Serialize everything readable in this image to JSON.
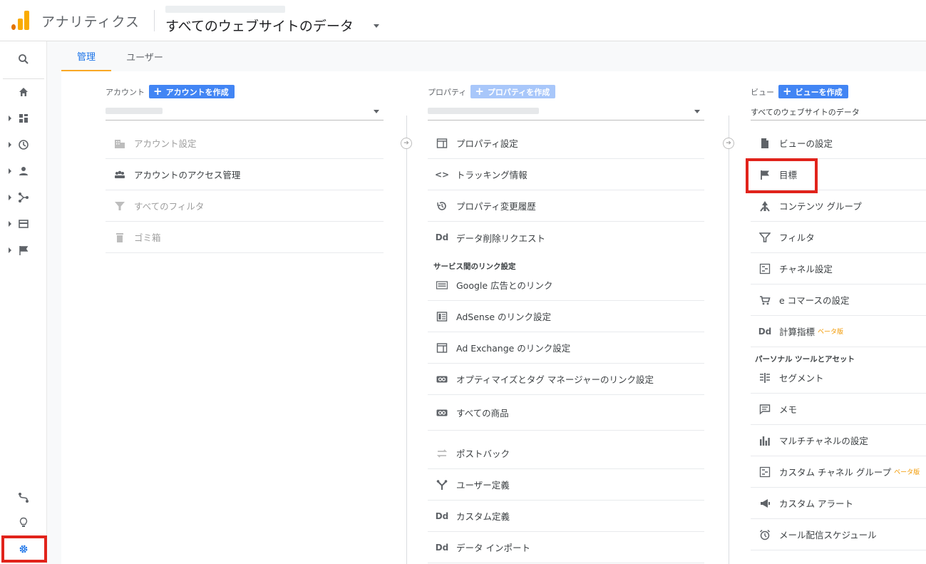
{
  "header": {
    "app_name": "アナリティクス",
    "view_title": "すべてのウェブサイトのデータ",
    "brand_colors": {
      "orange": "#f9ab00",
      "dark_orange": "#e37400"
    }
  },
  "left_nav": {
    "items": [
      {
        "name": "search-icon"
      },
      {
        "name": "home-icon"
      },
      {
        "name": "customization-icon"
      },
      {
        "name": "realtime-icon"
      },
      {
        "name": "audience-icon"
      },
      {
        "name": "acquisition-icon"
      },
      {
        "name": "behavior-icon"
      },
      {
        "name": "conversions-icon"
      },
      {
        "name": "attribution-icon"
      },
      {
        "name": "discover-icon"
      },
      {
        "name": "admin-gear-icon"
      }
    ]
  },
  "tabs": [
    {
      "label": "管理",
      "active": true
    },
    {
      "label": "ユーザー",
      "active": false
    }
  ],
  "account": {
    "label": "アカウント",
    "create_button": "アカウントを作成",
    "items": [
      {
        "label": "アカウント設定",
        "icon": "building-icon",
        "disabled": true
      },
      {
        "label": "アカウントのアクセス管理",
        "icon": "people-icon",
        "disabled": false
      },
      {
        "label": "すべてのフィルタ",
        "icon": "filter-icon",
        "disabled": true
      },
      {
        "label": "ゴミ箱",
        "icon": "trash-icon",
        "disabled": true
      }
    ]
  },
  "property": {
    "label": "プロパティ",
    "create_button": "プロパティを作成",
    "items": [
      {
        "label": "プロパティ設定",
        "icon": "window-icon"
      },
      {
        "label": "トラッキング情報",
        "icon": "code-icon",
        "glyph": "<>"
      },
      {
        "label": "プロパティ変更履歴",
        "icon": "history-icon"
      },
      {
        "label": "データ削除リクエスト",
        "icon": "dd-icon",
        "glyph": "Dd"
      }
    ],
    "section_title": "サービス間のリンク設定",
    "link_items": [
      {
        "label": "Google 広告とのリンク",
        "icon": "google-ads-icon"
      },
      {
        "label": "AdSense のリンク設定",
        "icon": "adsense-icon"
      },
      {
        "label": "Ad Exchange のリンク設定",
        "icon": "ad-exchange-icon"
      },
      {
        "label": "オプティマイズとタグ マネージャーのリンク設定",
        "icon": "link-icon"
      },
      {
        "label": "すべての商品",
        "icon": "link-icon"
      }
    ],
    "more_items": [
      {
        "label": "ポストバック",
        "icon": "postback-icon"
      },
      {
        "label": "ユーザー定義",
        "icon": "user-defined-icon"
      },
      {
        "label": "カスタム定義",
        "icon": "dd-icon",
        "glyph": "Dd"
      },
      {
        "label": "データ インポート",
        "icon": "dd-icon",
        "glyph": "Dd"
      }
    ]
  },
  "view": {
    "label": "ビュー",
    "create_button": "ビューを作成",
    "selected": "すべてのウェブサイトのデータ",
    "items": [
      {
        "label": "ビューの設定",
        "icon": "document-icon"
      },
      {
        "label": "目標",
        "icon": "flag-icon"
      },
      {
        "label": "コンテンツ グループ",
        "icon": "content-group-icon"
      },
      {
        "label": "フィルタ",
        "icon": "filter-icon"
      },
      {
        "label": "チャネル設定",
        "icon": "channel-icon"
      },
      {
        "label": "e コマースの設定",
        "icon": "cart-icon"
      },
      {
        "label": "計算指標",
        "icon": "dd-icon",
        "glyph": "Dd",
        "badge": "ベータ版"
      }
    ],
    "section_title": "パーソナル ツールとアセット",
    "tool_items": [
      {
        "label": "セグメント",
        "icon": "segment-icon"
      },
      {
        "label": "メモ",
        "icon": "annotation-icon"
      },
      {
        "label": "マルチチャネルの設定",
        "icon": "bar-chart-icon"
      },
      {
        "label": "カスタム チャネル グループ",
        "icon": "channel-icon",
        "badge": "ベータ版"
      },
      {
        "label": "カスタム アラート",
        "icon": "megaphone-icon"
      },
      {
        "label": "メール配信スケジュール",
        "icon": "alarm-icon"
      }
    ]
  },
  "highlight_color": "#e1231b",
  "accent_color": "#1a73e8"
}
